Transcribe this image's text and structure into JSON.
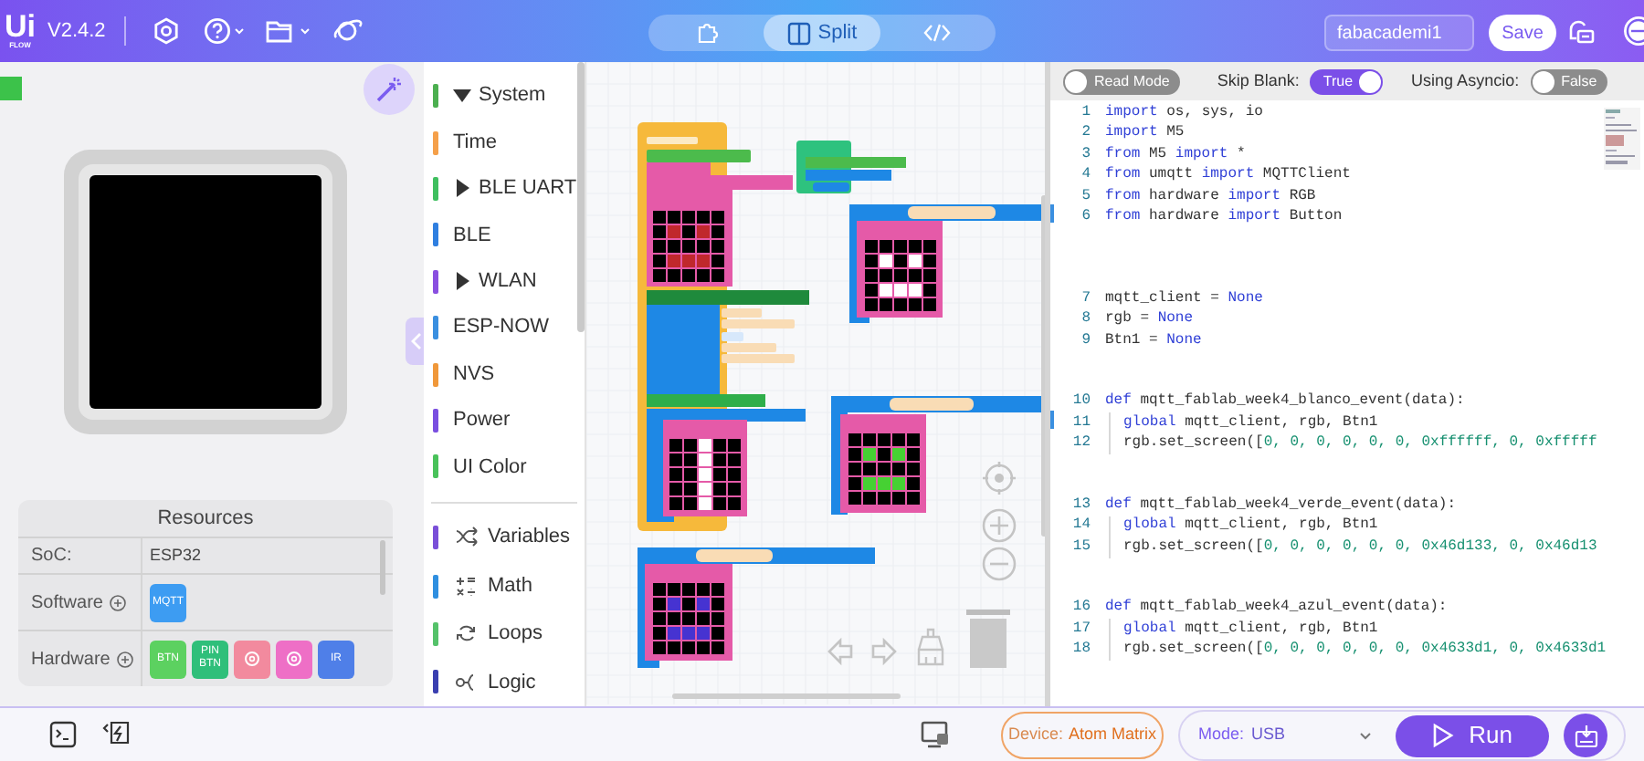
{
  "header": {
    "logo": "Ui",
    "logo_sub": "FLOW",
    "version": "V2.4.2",
    "view_tabs": [
      {
        "kind": "blocks",
        "selected": false
      },
      {
        "kind": "split",
        "label": "Split",
        "selected": true
      },
      {
        "kind": "code",
        "selected": false
      }
    ],
    "project_name": "fabacademi1",
    "save": "Save"
  },
  "resources": {
    "title": "Resources",
    "rows": [
      {
        "kind": "text",
        "label": "SoC:",
        "value": "ESP32"
      },
      {
        "kind": "chips",
        "label": "Software",
        "chips": [
          {
            "kind": "text",
            "label": "MQTT",
            "color": "#3d9cf2"
          }
        ]
      },
      {
        "kind": "chips",
        "label": "Hardware",
        "chips": [
          {
            "kind": "text",
            "label": "BTN",
            "color": "#5cd160"
          },
          {
            "kind": "text",
            "label": "PIN BTN",
            "color": "#2fbf7a"
          },
          {
            "kind": "icon",
            "color": "#f28a9e"
          },
          {
            "kind": "icon",
            "color": "#ee6fc6"
          },
          {
            "kind": "text",
            "label": "IR",
            "color": "#4f7fe8"
          }
        ]
      }
    ]
  },
  "categories": [
    {
      "label": "System",
      "kind": "folder",
      "expanded": true,
      "color": "#4caf50"
    },
    {
      "label": "Time",
      "kind": "leaf",
      "color": "#f5a04a"
    },
    {
      "label": "BLE UART",
      "kind": "folder",
      "expanded": false,
      "color": "#3fbf5f"
    },
    {
      "label": "BLE",
      "kind": "leaf",
      "color": "#2f7fe0"
    },
    {
      "label": "WLAN",
      "kind": "folder",
      "expanded": false,
      "color": "#8a4fe0"
    },
    {
      "label": "ESP-NOW",
      "kind": "leaf",
      "color": "#3a8fe0"
    },
    {
      "label": "NVS",
      "kind": "leaf",
      "color": "#f0983a"
    },
    {
      "label": "Power",
      "kind": "leaf",
      "color": "#7a4fe0"
    },
    {
      "label": "UI Color",
      "kind": "leaf",
      "color": "#49c25a"
    }
  ],
  "categories_2": [
    {
      "label": "Variables",
      "color": "#7a4fd8"
    },
    {
      "label": "Math",
      "color": "#2f8fe0"
    },
    {
      "label": "Loops",
      "color": "#55c26a"
    },
    {
      "label": "Logic",
      "color": "#3a3fb0"
    }
  ],
  "code_toolbar": {
    "read_mode": {
      "label": "Read Mode",
      "on": false
    },
    "skip_blank": {
      "label": "Skip Blank:",
      "value": "True",
      "on": true
    },
    "asyncio": {
      "label": "Using Asyncio:",
      "value": "False",
      "on": false
    }
  },
  "code_blocks": [
    [
      {
        "no": "1",
        "tokens": [
          {
            "kind": "keyword",
            "text": "import"
          },
          {
            "kind": "plain",
            "text": " os, sys, io"
          }
        ]
      },
      {
        "no": "2",
        "tokens": [
          {
            "kind": "keyword",
            "text": "import"
          },
          {
            "kind": "plain",
            "text": " M5"
          }
        ]
      },
      {
        "no": "3",
        "tokens": [
          {
            "kind": "keyword",
            "text": "from"
          },
          {
            "kind": "plain",
            "text": " M5 "
          },
          {
            "kind": "keyword",
            "text": "import"
          },
          {
            "kind": "plain",
            "text": " *"
          }
        ]
      },
      {
        "no": "4",
        "tokens": [
          {
            "kind": "keyword",
            "text": "from"
          },
          {
            "kind": "plain",
            "text": " umqtt "
          },
          {
            "kind": "keyword",
            "text": "import"
          },
          {
            "kind": "plain",
            "text": " MQTTClient"
          }
        ]
      },
      {
        "no": "5",
        "tokens": [
          {
            "kind": "keyword",
            "text": "from"
          },
          {
            "kind": "plain",
            "text": " hardware "
          },
          {
            "kind": "keyword",
            "text": "import"
          },
          {
            "kind": "plain",
            "text": " RGB"
          }
        ]
      },
      {
        "no": "6",
        "tokens": [
          {
            "kind": "keyword",
            "text": "from"
          },
          {
            "kind": "plain",
            "text": " hardware "
          },
          {
            "kind": "keyword",
            "text": "import"
          },
          {
            "kind": "plain",
            "text": " Button"
          }
        ]
      }
    ],
    [
      {
        "no": "7",
        "tokens": [
          {
            "kind": "plain",
            "text": "mqtt_client = "
          },
          {
            "kind": "keyword",
            "text": "None"
          }
        ]
      },
      {
        "no": "8",
        "tokens": [
          {
            "kind": "plain",
            "text": "rgb = "
          },
          {
            "kind": "keyword",
            "text": "None"
          }
        ]
      },
      {
        "no": "9",
        "tokens": [
          {
            "kind": "plain",
            "text": "Btn1 = "
          },
          {
            "kind": "keyword",
            "text": "None"
          }
        ]
      }
    ],
    [
      {
        "no": "10",
        "tokens": [
          {
            "kind": "keyword",
            "text": "def"
          },
          {
            "kind": "plain",
            "text": " mqtt_fablab_week4_blanco_event(data):"
          }
        ]
      },
      {
        "no": "11",
        "indented": true,
        "tokens": [
          {
            "kind": "keyword",
            "text": "global"
          },
          {
            "kind": "plain",
            "text": " mqtt_client, rgb, Btn1"
          }
        ]
      },
      {
        "no": "12",
        "indented": true,
        "tokens": [
          {
            "kind": "plain",
            "text": "rgb.set_screen(["
          },
          {
            "kind": "number",
            "text": "0, 0, 0, 0, 0, 0, 0xffffff, 0, 0xfffff"
          }
        ]
      }
    ],
    [
      {
        "no": "13",
        "tokens": [
          {
            "kind": "keyword",
            "text": "def"
          },
          {
            "kind": "plain",
            "text": " mqtt_fablab_week4_verde_event(data):"
          }
        ]
      },
      {
        "no": "14",
        "indented": true,
        "tokens": [
          {
            "kind": "keyword",
            "text": "global"
          },
          {
            "kind": "plain",
            "text": " mqtt_client, rgb, Btn1"
          }
        ]
      },
      {
        "no": "15",
        "indented": true,
        "tokens": [
          {
            "kind": "plain",
            "text": "rgb.set_screen(["
          },
          {
            "kind": "number",
            "text": "0, 0, 0, 0, 0, 0, 0x46d133, 0, 0x46d13"
          }
        ]
      }
    ],
    [
      {
        "no": "16",
        "tokens": [
          {
            "kind": "keyword",
            "text": "def"
          },
          {
            "kind": "plain",
            "text": " mqtt_fablab_week4_azul_event(data):"
          }
        ]
      },
      {
        "no": "17",
        "indented": true,
        "tokens": [
          {
            "kind": "keyword",
            "text": "global"
          },
          {
            "kind": "plain",
            "text": " mqtt_client, rgb, Btn1"
          }
        ]
      },
      {
        "no": "18",
        "indented": true,
        "tokens": [
          {
            "kind": "plain",
            "text": "rgb.set_screen(["
          },
          {
            "kind": "number",
            "text": "0, 0, 0, 0, 0, 0, 0x4633d1, 0, 0x4633d1"
          }
        ]
      }
    ]
  ],
  "footer": {
    "device_label": "Device:",
    "device": "Atom Matrix",
    "mode_label": "Mode:",
    "mode": "USB",
    "run": "Run"
  }
}
